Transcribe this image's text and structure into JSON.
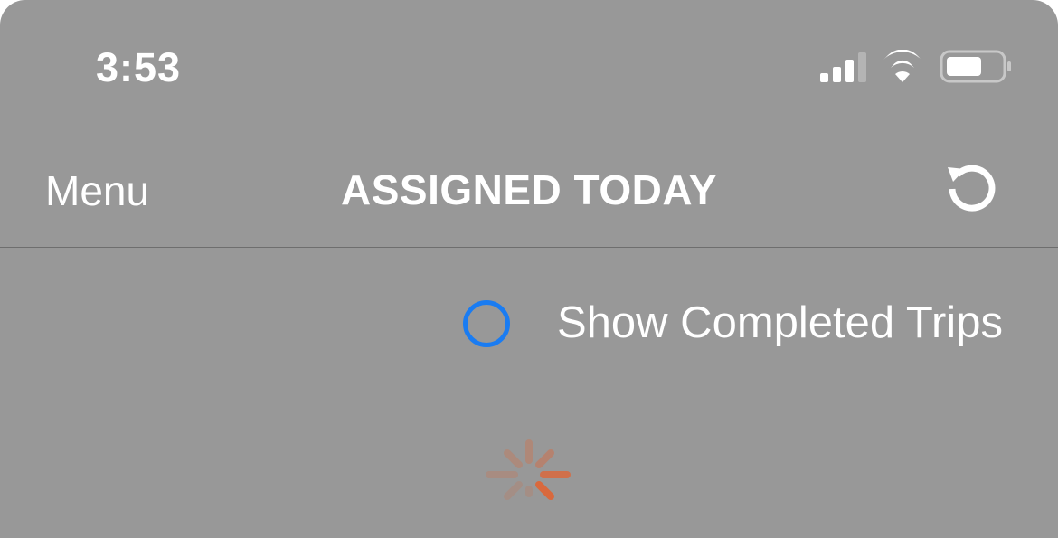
{
  "status_bar": {
    "time": "3:53",
    "icons": [
      "cellular-signal-icon",
      "wifi-icon",
      "battery-icon"
    ]
  },
  "nav": {
    "menu_label": "Menu",
    "title": "ASSIGNED TODAY",
    "refresh_icon": "refresh-icon"
  },
  "filter": {
    "show_completed_label": "Show Completed Trips",
    "show_completed_checked": false
  },
  "loading": {
    "spinner_icon": "loading-spinner-icon"
  },
  "colors": {
    "overlay_background": "#989898",
    "radio_accent": "#1a7cf2",
    "spinner_accent": "#d9693d",
    "text": "#ffffff"
  }
}
